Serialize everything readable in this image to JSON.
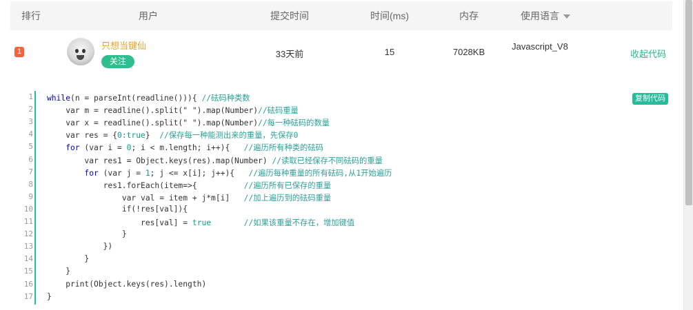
{
  "table_header": {
    "rank": "排行",
    "user": "用户",
    "submit_time": "提交时间",
    "runtime": "时间(ms)",
    "memory": "内存",
    "language": "使用语言"
  },
  "submission": {
    "rank": "1",
    "username": "只想当键仙",
    "follow_label": "关注",
    "submit_time": "33天前",
    "runtime": "15",
    "memory": "7028KB",
    "language": "Javascript_V8",
    "collapse_label": "收起代码"
  },
  "code": {
    "copy_label": "复制代码",
    "line_numbers": [
      "1",
      "2",
      "3",
      "4",
      "5",
      "6",
      "7",
      "8",
      "9",
      "10",
      "11",
      "12",
      "13",
      "14",
      "15",
      "16",
      "17"
    ],
    "lines": [
      [
        [
          "kw",
          "while"
        ],
        [
          "",
          "(n = parseInt(readline())){ "
        ],
        [
          "cm",
          "//砝码种类数"
        ]
      ],
      [
        [
          "",
          "    var m = readline().split(\" \").map(Number)"
        ],
        [
          "cm",
          "//砝码重量"
        ]
      ],
      [
        [
          "",
          "    var x = readline().split(\" \").map(Number)"
        ],
        [
          "cm",
          "//每一种砝码的数量"
        ]
      ],
      [
        [
          "",
          "    var res = {"
        ],
        [
          "nm",
          "0:true"
        ],
        [
          "",
          "}  "
        ],
        [
          "cm",
          "//保存每一种能测出来的重量，先保存0"
        ]
      ],
      [
        [
          "kw",
          "    for"
        ],
        [
          "",
          ". (var i = "
        ],
        [
          "nm",
          "0"
        ],
        [
          "",
          "; i < m.length; i++){   "
        ],
        [
          "cm",
          "//遍历所有种类的砝码"
        ]
      ],
      [
        [
          "",
          "        var res1 = Object.keys(res).map(Number) "
        ],
        [
          "cm",
          "//读取已经保存不同砝码的重量"
        ]
      ],
      [
        [
          "kw",
          "        for"
        ],
        [
          "",
          ". (var j = "
        ],
        [
          "nm",
          "1"
        ],
        [
          "",
          "; j <= x[i]; j++){   "
        ],
        [
          "cm",
          "//遍历每种重量的所有砝码,从1开始遍历"
        ]
      ],
      [
        [
          "",
          "            res1.forEach(item=>{          "
        ],
        [
          "cm",
          "//遍历所有已保存的重量"
        ]
      ],
      [
        [
          "",
          "                var val = item + j*m[i]   "
        ],
        [
          "cm",
          "//加上遍历到的砝码重量"
        ]
      ],
      [
        [
          "",
          "                if(!res[val]){"
        ]
      ],
      [
        [
          "",
          "                    res[val] = "
        ],
        [
          "nm",
          "true"
        ],
        [
          "",
          "       "
        ],
        [
          "cm",
          "//如果该重量不存在，增加键值"
        ]
      ],
      [
        [
          "",
          "                }"
        ]
      ],
      [
        [
          "",
          "            })"
        ]
      ],
      [
        [
          "",
          "        }"
        ]
      ],
      [
        [
          "",
          "    }"
        ]
      ],
      [
        [
          "",
          "    print(Object.keys(res).length)"
        ]
      ],
      [
        [
          "",
          "}"
        ]
      ]
    ]
  }
}
